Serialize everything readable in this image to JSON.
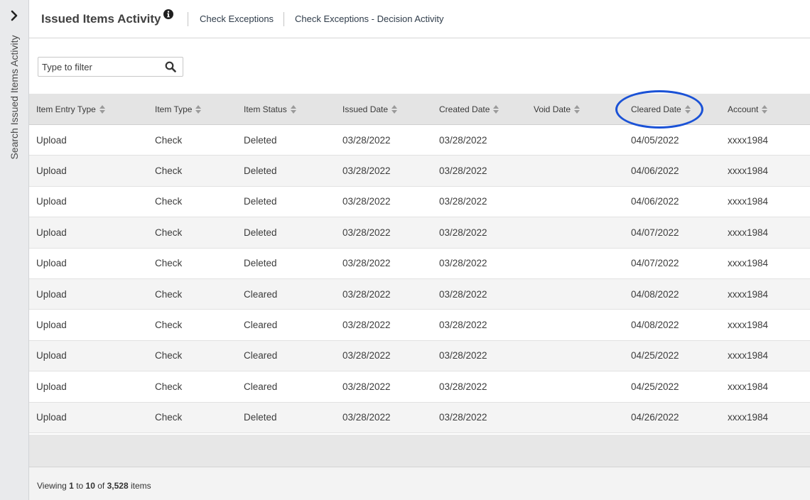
{
  "side_panel": {
    "label": "Search Issued Items Activity",
    "toggle_icon": "chevron-right-icon"
  },
  "header": {
    "title": "Issued Items Activity",
    "info_icon": "info-icon",
    "links": [
      "Check Exceptions",
      "Check Exceptions - Decision Activity"
    ]
  },
  "filter": {
    "placeholder": "Type to filter",
    "value": "",
    "icon": "search-icon"
  },
  "table": {
    "columns": [
      "Item Entry Type",
      "Item Type",
      "Item Status",
      "Issued Date",
      "Created Date",
      "Void Date",
      "Cleared Date",
      "Account"
    ],
    "rows": [
      [
        "Upload",
        "Check",
        "Deleted",
        "03/28/2022",
        "03/28/2022",
        "",
        "04/05/2022",
        "xxxx1984"
      ],
      [
        "Upload",
        "Check",
        "Deleted",
        "03/28/2022",
        "03/28/2022",
        "",
        "04/06/2022",
        "xxxx1984"
      ],
      [
        "Upload",
        "Check",
        "Deleted",
        "03/28/2022",
        "03/28/2022",
        "",
        "04/06/2022",
        "xxxx1984"
      ],
      [
        "Upload",
        "Check",
        "Deleted",
        "03/28/2022",
        "03/28/2022",
        "",
        "04/07/2022",
        "xxxx1984"
      ],
      [
        "Upload",
        "Check",
        "Deleted",
        "03/28/2022",
        "03/28/2022",
        "",
        "04/07/2022",
        "xxxx1984"
      ],
      [
        "Upload",
        "Check",
        "Cleared",
        "03/28/2022",
        "03/28/2022",
        "",
        "04/08/2022",
        "xxxx1984"
      ],
      [
        "Upload",
        "Check",
        "Cleared",
        "03/28/2022",
        "03/28/2022",
        "",
        "04/08/2022",
        "xxxx1984"
      ],
      [
        "Upload",
        "Check",
        "Cleared",
        "03/28/2022",
        "03/28/2022",
        "",
        "04/25/2022",
        "xxxx1984"
      ],
      [
        "Upload",
        "Check",
        "Cleared",
        "03/28/2022",
        "03/28/2022",
        "",
        "04/25/2022",
        "xxxx1984"
      ],
      [
        "Upload",
        "Check",
        "Deleted",
        "03/28/2022",
        "03/28/2022",
        "",
        "04/26/2022",
        "xxxx1984"
      ]
    ],
    "highlighted_column": "Cleared Date",
    "highlight_color": "#1b52d6"
  },
  "footer": {
    "prefix": "Viewing",
    "from": "1",
    "to_word": "to",
    "to": "10",
    "of_word": "of",
    "total": "3,528",
    "suffix": "items"
  }
}
